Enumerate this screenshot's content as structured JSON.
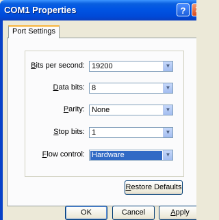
{
  "window": {
    "title": "COM1 Properties",
    "help_glyph": "?",
    "close_glyph": "✕"
  },
  "tabs": [
    {
      "label": "Port Settings",
      "active": true
    }
  ],
  "settings": [
    {
      "key": "B",
      "label_rest": "its per second:",
      "value": "19200"
    },
    {
      "key": "D",
      "label_rest": "ata bits:",
      "value": "8"
    },
    {
      "key": "P",
      "label_rest": "arity:",
      "value": "None"
    },
    {
      "key": "S",
      "label_rest": "top bits:",
      "value": "1"
    },
    {
      "key": "F",
      "label_rest": "low control:",
      "value": "Hardware"
    }
  ],
  "buttons": {
    "restore": {
      "key": "R",
      "label_rest": "estore Defaults"
    },
    "ok": {
      "label": "OK"
    },
    "cancel": {
      "label": "Cancel"
    },
    "apply": {
      "key": "A",
      "label_rest": "pply"
    }
  },
  "icons": {
    "dropdown": "▼"
  },
  "colors": {
    "title_bar": "#0054e3",
    "selection": "#316ac5",
    "tab_accent": "#f8b33a"
  }
}
